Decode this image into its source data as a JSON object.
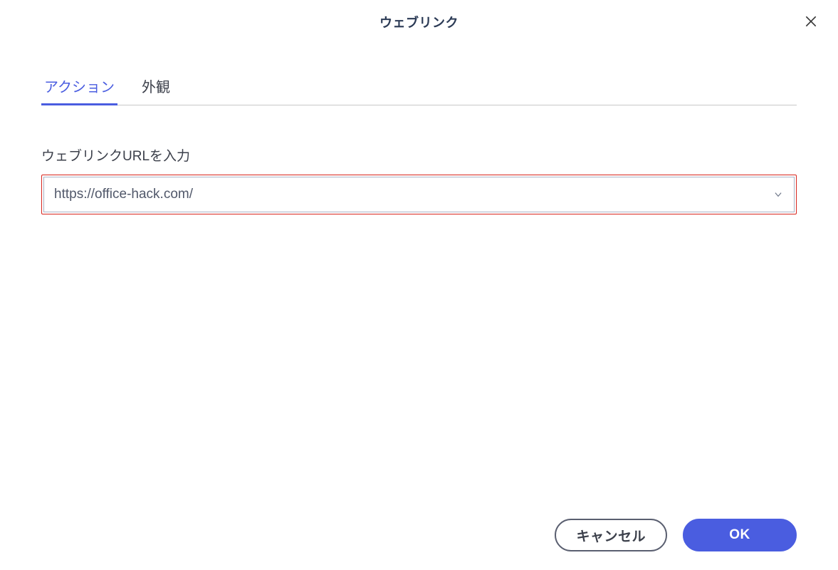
{
  "dialog": {
    "title": "ウェブリンク"
  },
  "tabs": {
    "action": "アクション",
    "appearance": "外観"
  },
  "field": {
    "label": "ウェブリンクURLを入力",
    "value": "https://office-hack.com/"
  },
  "buttons": {
    "cancel": "キャンセル",
    "ok": "OK"
  }
}
